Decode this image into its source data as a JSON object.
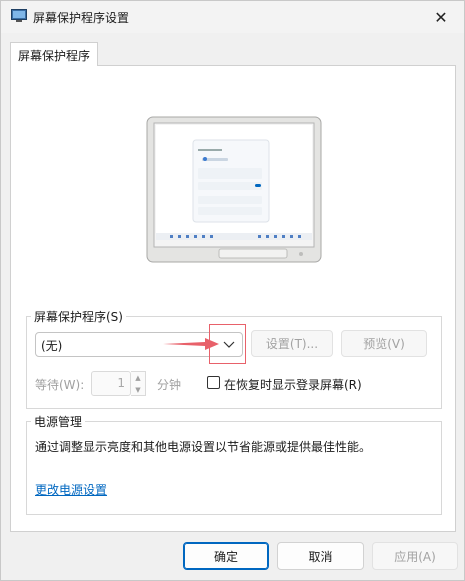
{
  "window": {
    "title": "屏幕保护程序设置",
    "close_glyph": "✕"
  },
  "tabs": [
    {
      "label": "屏幕保护程序"
    }
  ],
  "screensaver": {
    "group_label": "屏幕保护程序(S)",
    "selected_value": "(无)",
    "settings_label": "设置(T)...",
    "preview_label": "预览(V)",
    "wait_label": "等待(W):",
    "wait_value": "1",
    "wait_unit": "分钟",
    "resume_checkbox_label": "在恢复时显示登录屏幕(R)",
    "resume_checked": false
  },
  "power": {
    "group_label": "电源管理",
    "description": "通过调整显示亮度和其他电源设置以节省能源或提供最佳性能。",
    "link_label": "更改电源设置"
  },
  "footer": {
    "ok_label": "确定",
    "cancel_label": "取消",
    "apply_label": "应用(A)"
  },
  "annotation": {
    "color": "#e8616a"
  },
  "colors": {
    "accent": "#0067c0",
    "dialog_bg": "#f0f0f0",
    "panel_bg": "#ffffff"
  }
}
